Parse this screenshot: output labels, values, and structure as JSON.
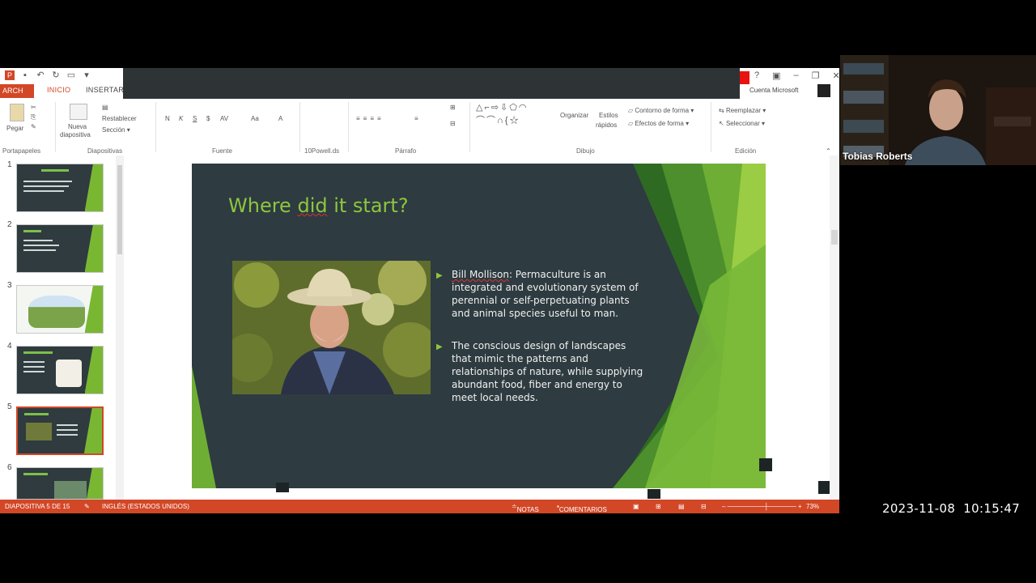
{
  "ppt": {
    "tabs": {
      "file": "ARCH",
      "home": "INICIO",
      "insert": "INSERTAR"
    },
    "account": "Cuenta Microsoft",
    "ribbon": {
      "paste": "Pegar",
      "new_slide_line1": "Nueva",
      "new_slide_line2": "diapositiva",
      "reset": "Restablecer",
      "section": "Sección",
      "arrange": "Organizar",
      "quick_styles_line1": "Estilos",
      "quick_styles_line2": "rápidos",
      "shape_outline": "Contorno de forma",
      "shape_effects": "Efectos de forma",
      "replace": "Reemplazar",
      "select": "Seleccionar",
      "groups": {
        "clipboard": "Portapapeles",
        "slides": "Diapositivas",
        "font": "Fuente",
        "smartart": "10Powell.ds",
        "paragraph": "Párrafo",
        "drawing": "Dibujo",
        "editing": "Edición"
      },
      "font_buttons": [
        "N",
        "K",
        "S",
        "$",
        "AV",
        "Aa",
        "A"
      ]
    },
    "thumbnails": [
      {
        "num": "1",
        "title": "Permaculture 101"
      },
      {
        "num": "2",
        "title": ""
      },
      {
        "num": "3",
        "title": ""
      },
      {
        "num": "4",
        "title": ""
      },
      {
        "num": "5",
        "title": "Where did it start"
      },
      {
        "num": "6",
        "title": ""
      }
    ],
    "slide": {
      "title_pre": "Where ",
      "title_err": "did",
      "title_post": " it start?",
      "bullet1_name": "Bill Mollison",
      "bullet1_text": ": Permaculture is an integrated and evolutionary system of perennial or self-perpetuating plants and animal species useful to man.",
      "bullet2_text": "The conscious design of landscapes that mimic the patterns and relationships of nature, while supplying abundant food, fiber and energy to meet local needs.",
      "photo_alt": "Bill Mollison",
      "colors": {
        "background": "#2e3b40",
        "accent": "#8dc63f"
      }
    },
    "status": {
      "slide_counter": "DIAPOSITIVA 5 DE 15",
      "language": "INGLÉS (ESTADOS UNIDOS)",
      "notes": "NOTAS",
      "comments": "COMENTARIOS",
      "zoom": "73%"
    }
  },
  "webcam": {
    "name": "Tobias Roberts"
  },
  "timestamp": "2023-11-08  10:15:47"
}
